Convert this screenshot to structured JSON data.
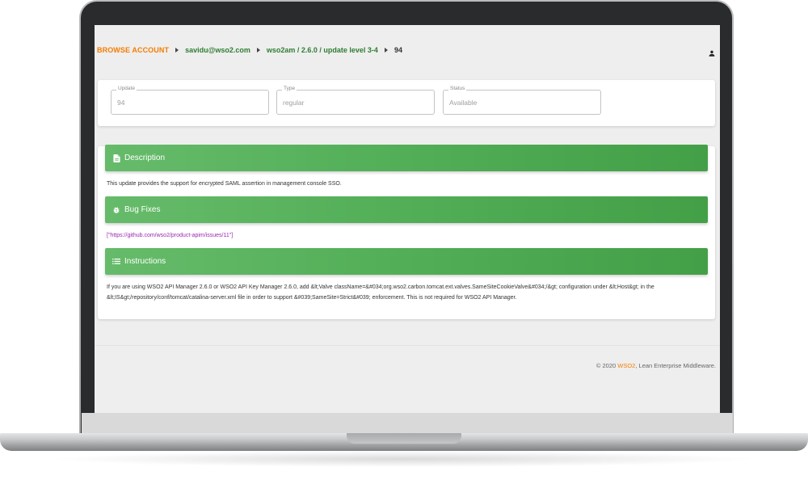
{
  "breadcrumb": {
    "root": "BROWSE ACCOUNT",
    "account": "savidu@wso2.com",
    "product": "wso2am / 2.6.0 / update level 3-4",
    "current": "94"
  },
  "fields": {
    "update": {
      "label": "Update",
      "value": "94"
    },
    "type": {
      "label": "Type",
      "value": "regular"
    },
    "status": {
      "label": "Status",
      "value": "Available"
    }
  },
  "sections": {
    "description": {
      "title": "Description",
      "text": "This update provides the support for encrypted SAML assertion in management console SSO."
    },
    "bug_fixes": {
      "title": "Bug Fixes",
      "text": "[\"https://github.com/wso2/product-apim/issues/11\"]"
    },
    "instructions": {
      "title": "Instructions",
      "text": "If you are using WSO2 API Manager 2.6.0 or WSO2 API Key Manager 2.6.0, add &lt;Valve className=&#034;org.wso2.carbon.tomcat.ext.valves.SameSiteCookieValve&#034;/&gt; configuration under &lt;Host&gt; in the &lt;IS&gt;/repository/conf/tomcat/catalina-server.xml file in order to support &#039;SameSite=Strict&#039; enforcement. This is not required for WSO2 API Manager."
    }
  },
  "footer": {
    "prefix": "© 2020 ",
    "brand": "WSO2",
    "suffix": ", Lean Enterprise Middleware."
  },
  "colors": {
    "accent_orange": "#f57c00",
    "accent_green": "#2e7d32",
    "section_header_green": "#4caf50",
    "link_purple": "#9c27b0"
  },
  "icons": {
    "user": "account-icon",
    "description": "file-document-icon",
    "bug_fixes": "bug-icon",
    "instructions": "list-icon"
  }
}
